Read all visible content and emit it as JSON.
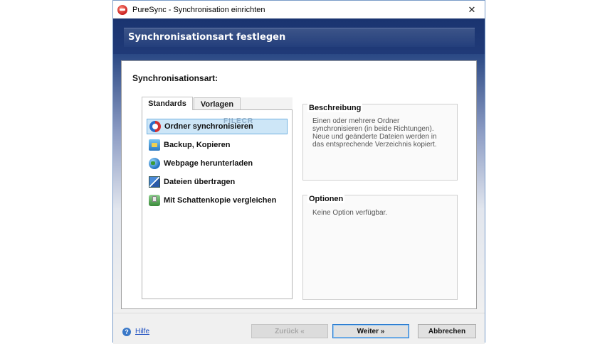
{
  "window": {
    "title": "PureSync - Synchronisation einrichten",
    "close_glyph": "✕"
  },
  "header": {
    "title": "Synchronisationsart festlegen"
  },
  "main": {
    "section_title": "Synchronisationsart:",
    "tabs": [
      {
        "label": "Standards",
        "active": true
      },
      {
        "label": "Vorlagen",
        "active": false
      }
    ],
    "items": [
      {
        "label": "Ordner synchronisieren",
        "icon": "sync-arrows-icon",
        "selected": true
      },
      {
        "label": "Backup, Kopieren",
        "icon": "backup-icon",
        "selected": false
      },
      {
        "label": "Webpage herunterladen",
        "icon": "globe-icon",
        "selected": false
      },
      {
        "label": "Dateien übertragen",
        "icon": "transfer-icon",
        "selected": false
      },
      {
        "label": "Mit Schattenkopie vergleichen",
        "icon": "shadow-copy-icon",
        "selected": false
      }
    ],
    "watermark": "FILECR"
  },
  "description": {
    "title": "Beschreibung",
    "lines": [
      "Einen oder mehrere Ordner",
      "synchronisieren (in beide Richtungen).",
      "Neue und geänderte Dateien werden in",
      "das entsprechende Verzeichnis kopiert."
    ]
  },
  "options": {
    "title": "Optionen",
    "text": "Keine Option verfügbar."
  },
  "footer": {
    "help_label": "Hilfe",
    "help_icon_glyph": "?",
    "back_label": "Zurück «",
    "next_label": "Weiter »",
    "cancel_label": "Abbrechen"
  }
}
